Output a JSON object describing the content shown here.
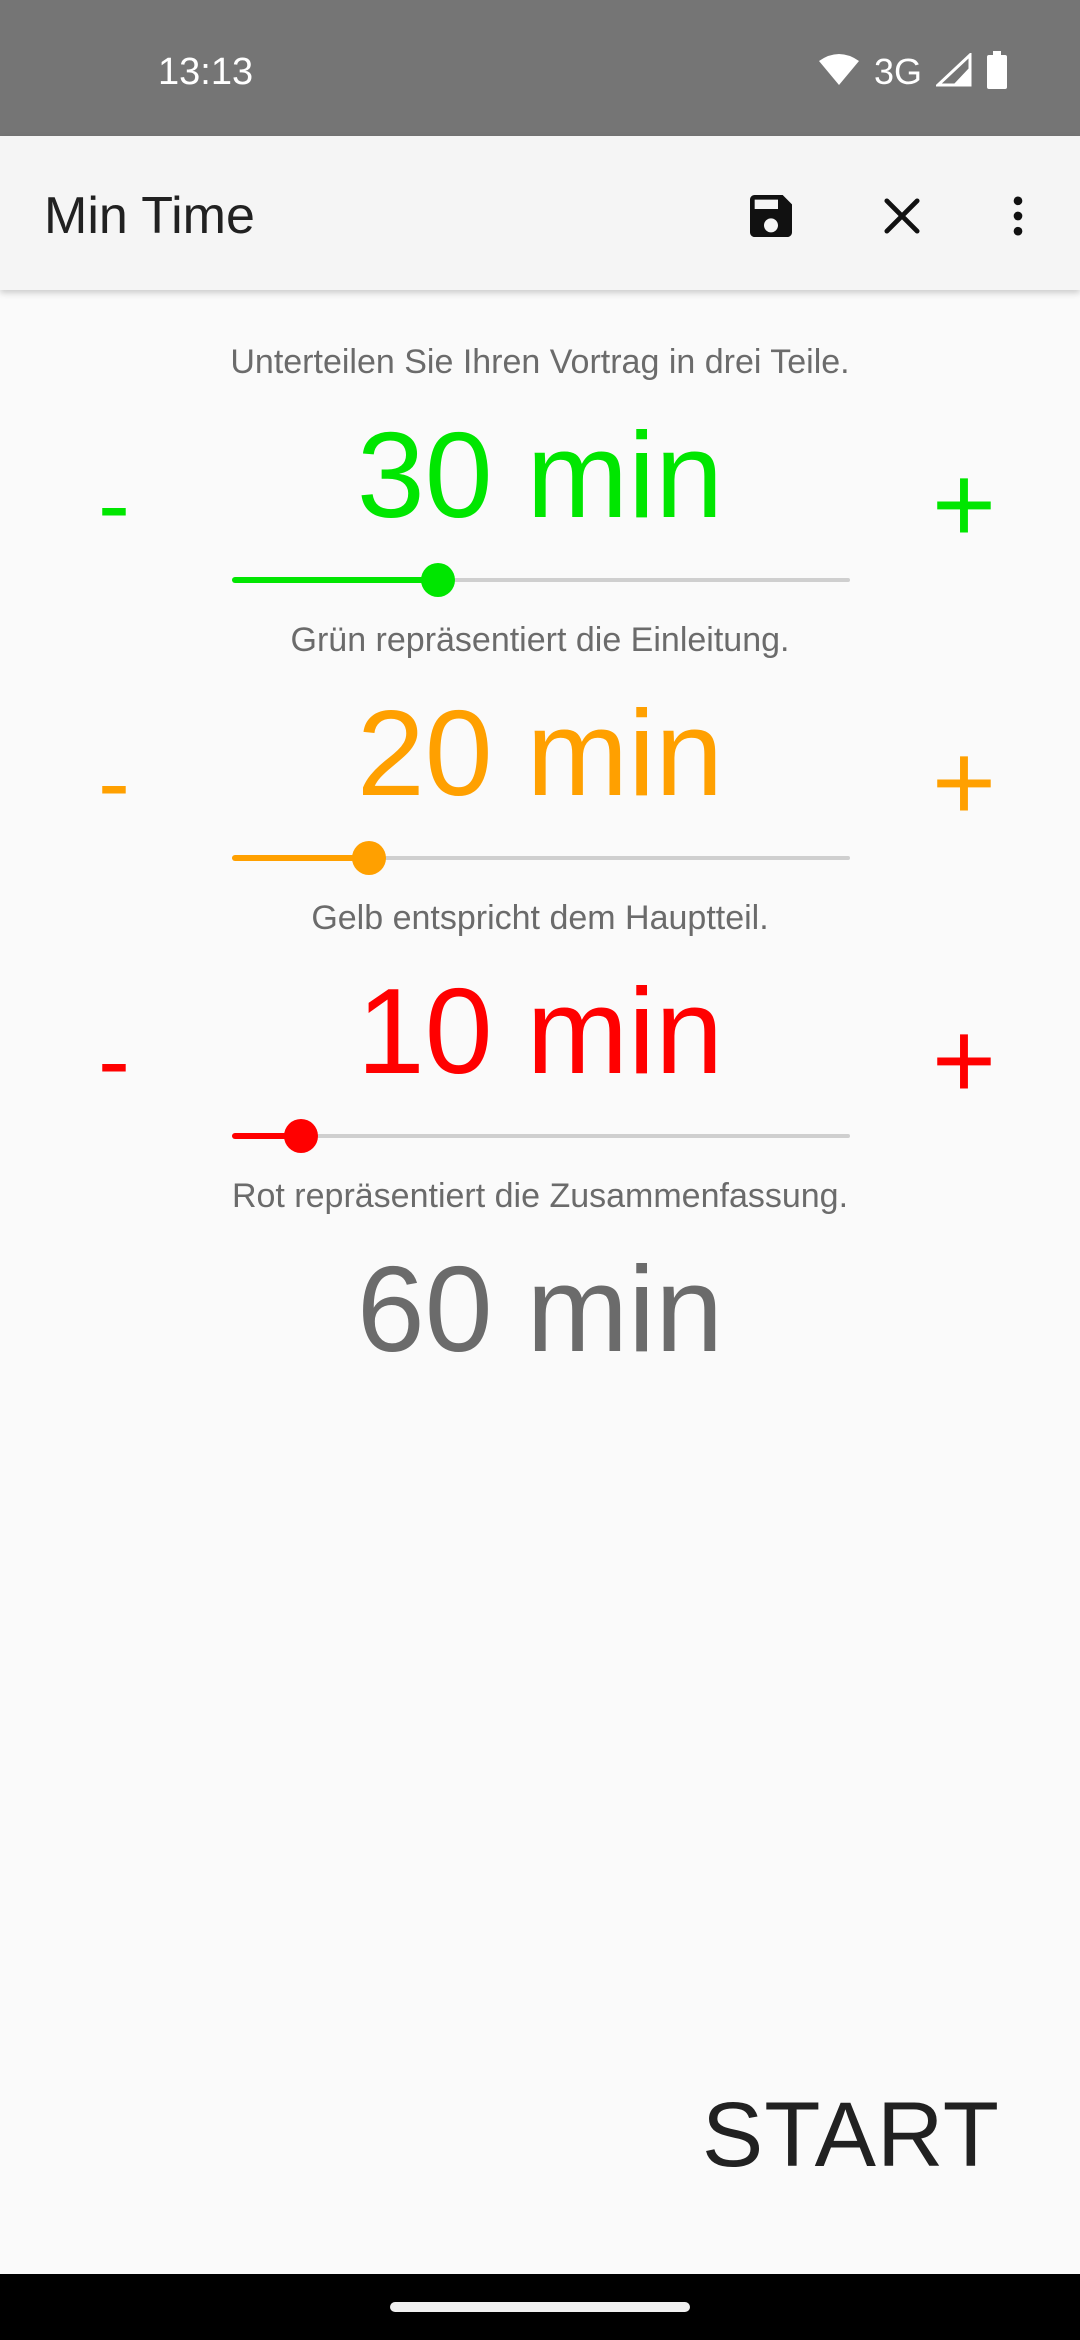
{
  "status_bar": {
    "time": "13:13",
    "network": "3G",
    "icons": [
      "wifi-icon",
      "cell-signal-icon",
      "battery-icon"
    ]
  },
  "app_bar": {
    "title": "Min Time",
    "actions": [
      "save-icon",
      "close-icon",
      "more-vert-icon"
    ]
  },
  "intro": "Unterteilen Sie Ihren Vortrag in drei Teile.",
  "sections": [
    {
      "time_label": "30 min",
      "minutes": 30,
      "slider_fraction": 0.333,
      "minus": "-",
      "plus": "+",
      "color": "#00e600",
      "caption": "Grün repräsentiert die Einleitung."
    },
    {
      "time_label": "20 min",
      "minutes": 20,
      "slider_fraction": 0.222,
      "minus": "-",
      "plus": "+",
      "color": "#ffa000",
      "caption": "Gelb entspricht dem Hauptteil."
    },
    {
      "time_label": "10 min",
      "minutes": 10,
      "slider_fraction": 0.111,
      "minus": "-",
      "plus": "+",
      "color": "#ff0000",
      "caption": "Rot repräsentiert die Zusammenfassung."
    }
  ],
  "total": {
    "label": "60 min",
    "color": "#6b6b6b"
  },
  "start_label": "START"
}
